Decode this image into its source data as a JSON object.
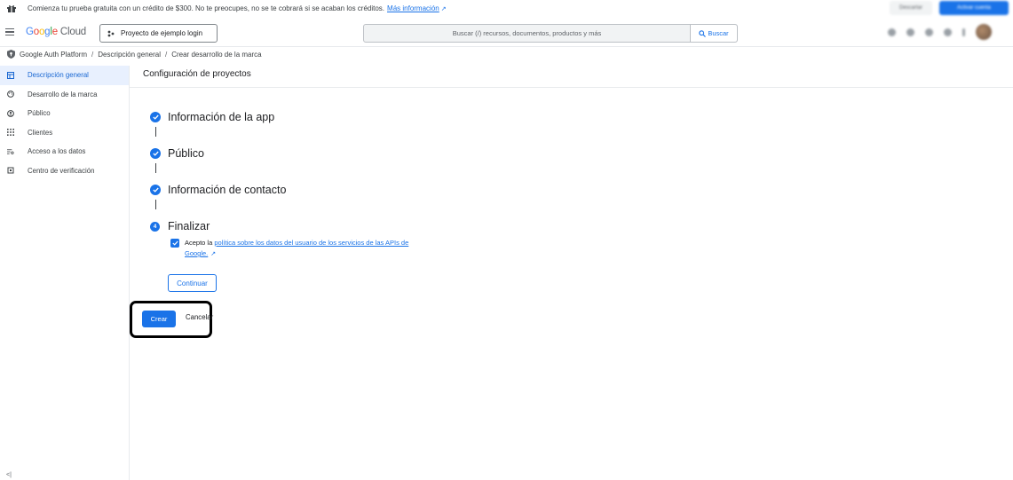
{
  "banner": {
    "text": "Comienza tu prueba gratuita con un crédito de $300. No te preocupes, no se te cobrará si se acaban los créditos.",
    "link": "Más información",
    "dismiss_label": "Descartar",
    "activate_label": "Activar cuenta"
  },
  "header": {
    "logo_parts": [
      "G",
      "o",
      "o",
      "g",
      "l",
      "e"
    ],
    "logo_suffix": "Cloud",
    "project_label": "Proyecto de ejemplo login",
    "search_placeholder": "Buscar (/) recursos, documentos, productos y más",
    "search_button": "Buscar"
  },
  "breadcrumb": {
    "items": [
      "Google Auth Platform",
      "Descripción general",
      "Crear desarrollo de la marca"
    ],
    "separator": "/"
  },
  "sidebar": {
    "items": [
      {
        "label": "Descripción general",
        "icon": "dashboard-icon",
        "active": true
      },
      {
        "label": "Desarrollo de la marca",
        "icon": "palette-icon",
        "active": false
      },
      {
        "label": "Público",
        "icon": "person-icon",
        "active": false
      },
      {
        "label": "Clientes",
        "icon": "grid-icon",
        "active": false
      },
      {
        "label": "Acceso a los datos",
        "icon": "data-access-icon",
        "active": false
      },
      {
        "label": "Centro de verificación",
        "icon": "verification-icon",
        "active": false
      }
    ],
    "collapse_label": "<|"
  },
  "main": {
    "title": "Configuración de proyectos",
    "steps": [
      {
        "label": "Información de la app",
        "status": "done"
      },
      {
        "label": "Público",
        "status": "done"
      },
      {
        "label": "Información de contacto",
        "status": "done"
      },
      {
        "label": "Finalizar",
        "status": "current",
        "number": "4"
      }
    ],
    "consent": {
      "prefix": "Acepto la",
      "link": "política sobre los datos del usuario de los servicios de las APIs de Google.",
      "checked": true
    },
    "continue_button": "Continuar",
    "create_button": "Crear",
    "cancel_button": "Cancelar"
  },
  "colors": {
    "accent": "#1a73e8",
    "active_bg": "#e8f0fe"
  }
}
